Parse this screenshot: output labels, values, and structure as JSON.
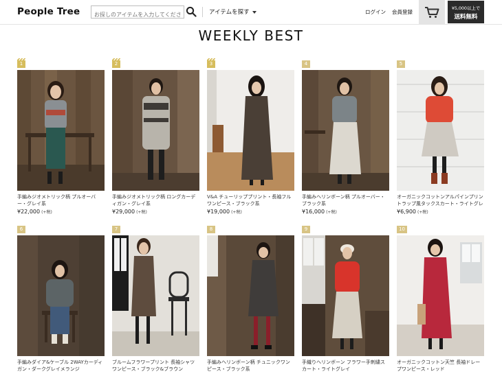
{
  "header": {
    "logo": "People Tree",
    "search_placeholder": "お探しのアイテムを入力してください",
    "find_item": "アイテムを探す",
    "login": "ログイン",
    "register": "会員登録",
    "shipping_small": "¥5,000以上で",
    "shipping_big": "送料無料",
    "icons": [
      "search-icon",
      "cart-icon",
      "chevron-down-icon"
    ]
  },
  "title": "WEEKLY BEST",
  "products": [
    {
      "rank": "1",
      "name": "手編みジオメトリック柄 プルオーバー・グレイ系",
      "price": "¥22,000",
      "tax": "(+税)"
    },
    {
      "rank": "2",
      "name": "手編みジオメトリック柄 ロングカーディガン・グレイ系",
      "price": "¥29,000",
      "tax": "(+税)"
    },
    {
      "rank": "3",
      "name": "V&A チューリッププリント・長袖フルワンピース・ブラック系",
      "price": "¥19,000",
      "tax": "(+税)"
    },
    {
      "rank": "4",
      "name": "手編みヘリンボーン柄 プルオーバー・ブラック系",
      "price": "¥16,000",
      "tax": "(+税)"
    },
    {
      "rank": "5",
      "name": "オーガニックコットンアルパインプリントラップ風タックスカート・ライトグレイ系",
      "price": "¥6,900",
      "tax": "(+税)"
    },
    {
      "rank": "6",
      "name": "手編みダイア&ケーブル 2WAYカーディガン・ダークグレイメランジ",
      "price": "",
      "tax": ""
    },
    {
      "rank": "7",
      "name": "ブルームフラワープリント 長袖シャツワンピース・ブラック&ブラウン",
      "price": "",
      "tax": ""
    },
    {
      "rank": "8",
      "name": "手編みヘリンボーン柄 チュニックワンピース・ブラック系",
      "price": "",
      "tax": ""
    },
    {
      "rank": "9",
      "name": "手織りヘリンボーン フラワー手刺繍スカート・ライトグレイ",
      "price": "",
      "tax": ""
    },
    {
      "rank": "10",
      "name": "オーガニックコットン天竺 長袖ドレープワンピース・レッド",
      "price": "",
      "tax": ""
    }
  ]
}
